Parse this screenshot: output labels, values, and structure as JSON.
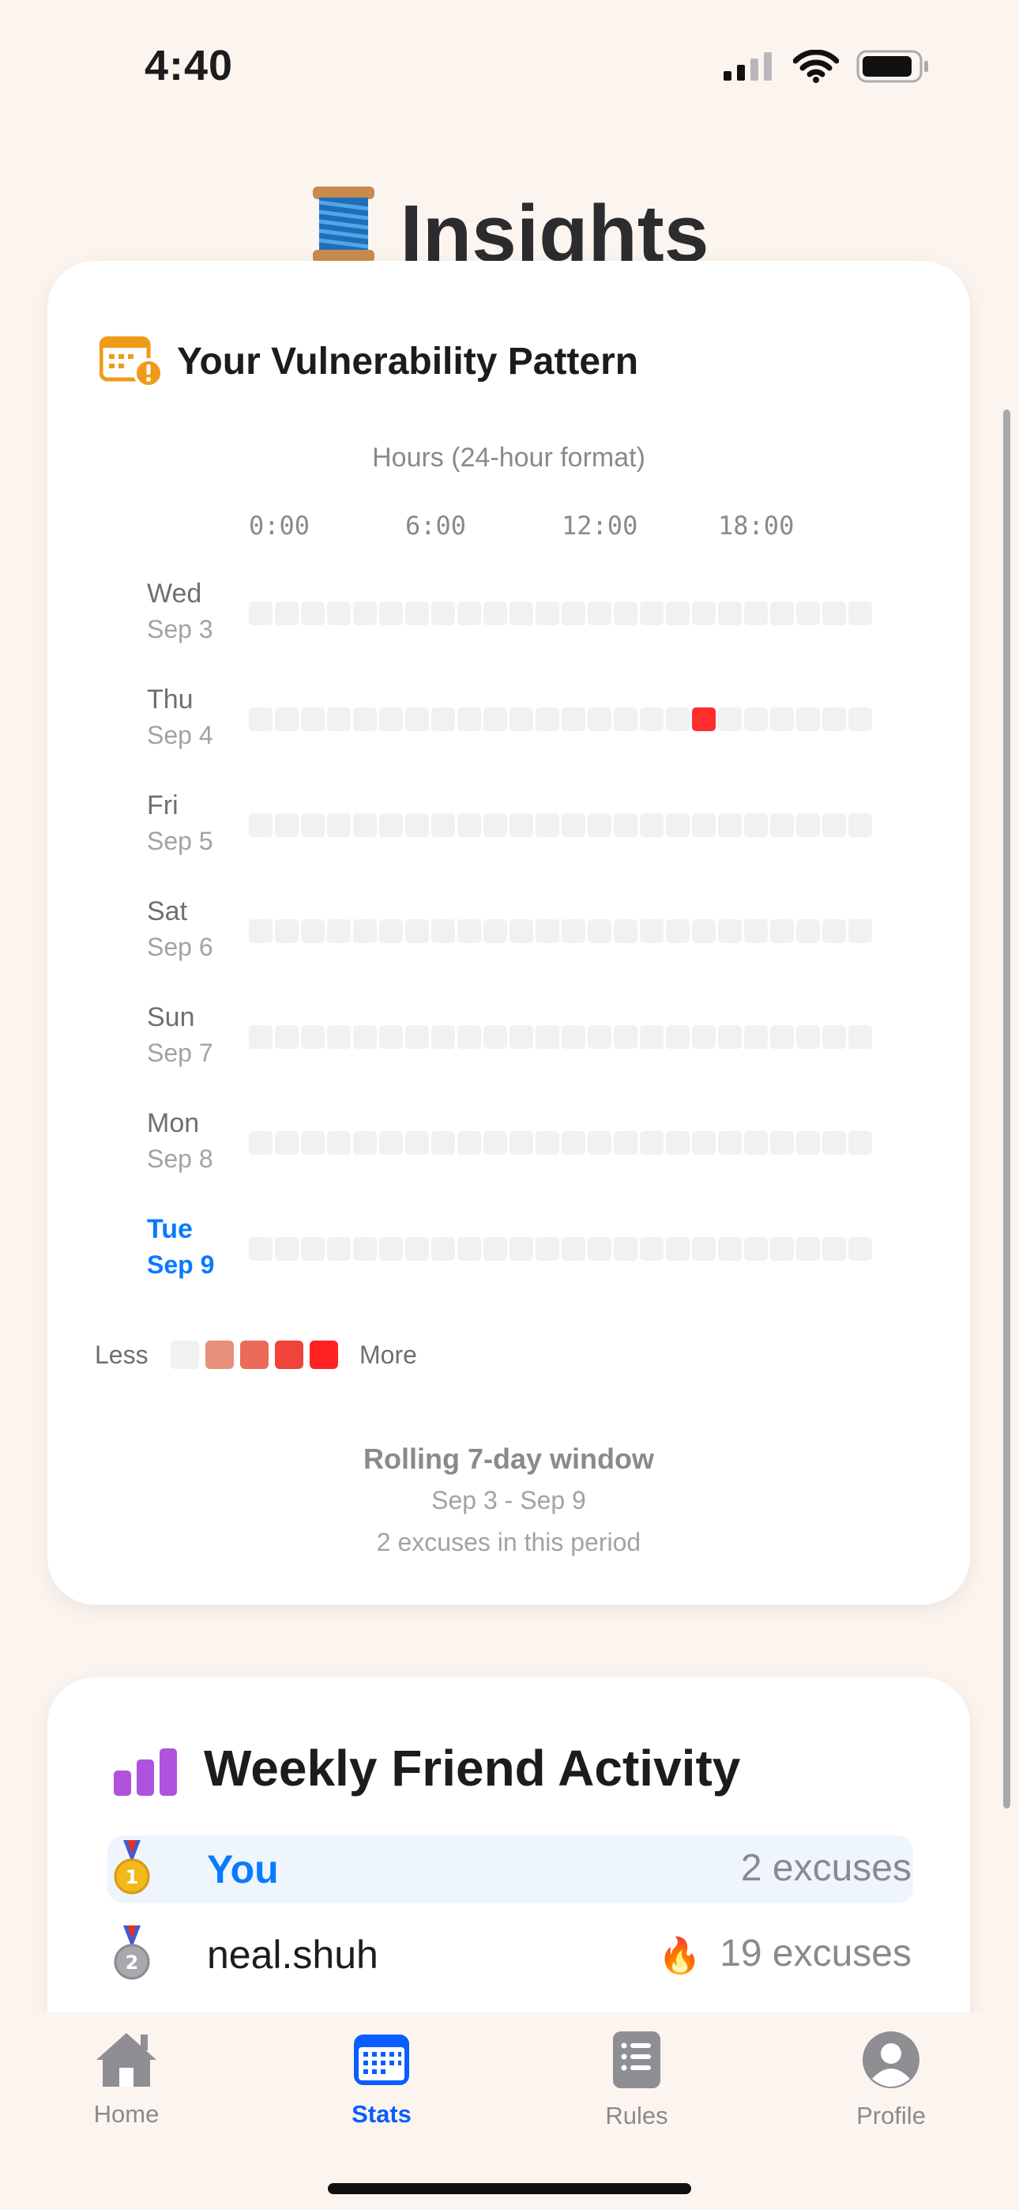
{
  "status_bar": {
    "time": "4:40"
  },
  "header": {
    "title": "Insights",
    "emoji": "🧵"
  },
  "heatmap_card": {
    "title": "Your Vulnerability Pattern",
    "axis_caption": "Hours (24-hour format)",
    "hour_labels": [
      "0:00",
      "6:00",
      "12:00",
      "18:00"
    ],
    "days": [
      {
        "name": "Wed",
        "date": "Sep 3",
        "active_hours": []
      },
      {
        "name": "Thu",
        "date": "Sep 4",
        "active_hours": [
          17
        ]
      },
      {
        "name": "Fri",
        "date": "Sep 5",
        "active_hours": []
      },
      {
        "name": "Sat",
        "date": "Sep 6",
        "active_hours": []
      },
      {
        "name": "Sun",
        "date": "Sep 7",
        "active_hours": []
      },
      {
        "name": "Mon",
        "date": "Sep 8",
        "active_hours": []
      },
      {
        "name": "Tue",
        "date": "Sep 9",
        "active_hours": [],
        "is_today": true
      }
    ],
    "legend": {
      "less": "Less",
      "more": "More",
      "colors": [
        "#F1F1F4",
        "#E8907A",
        "#EA6C58",
        "#F0443A",
        "#FF2222"
      ]
    },
    "window_title": "Rolling 7-day window",
    "window_range": "Sep 3 - Sep 9",
    "window_count": "2 excuses in this period"
  },
  "friends_card": {
    "title": "Weekly Friend Activity",
    "leaders": [
      {
        "name": "You",
        "count": "2 excuses",
        "medal": "1",
        "highlight": true
      },
      {
        "name": "neal.shuh",
        "count": "19 excuses",
        "medal": "2",
        "fire": "🔥"
      }
    ]
  },
  "tabs": [
    {
      "label": "Home",
      "icon": "house-icon"
    },
    {
      "label": "Stats",
      "icon": "calendar-grid-icon",
      "active": true
    },
    {
      "label": "Rules",
      "icon": "list-icon"
    },
    {
      "label": "Profile",
      "icon": "person-circle-icon"
    }
  ],
  "colors": {
    "accent": "#0A7AFF",
    "tab_active": "#0A5DFF",
    "heat_hot": "#FF2D2D",
    "background": "#FCF5EF"
  }
}
